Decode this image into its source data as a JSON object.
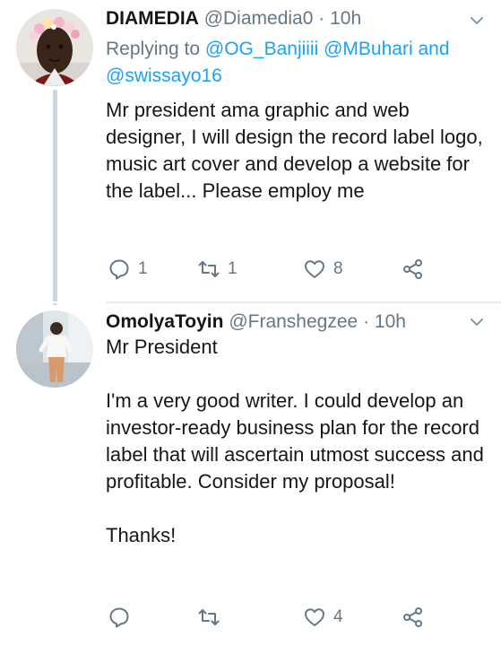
{
  "tweets": [
    {
      "name": "DIAMEDIA",
      "handle": "@Diamedia0",
      "separator": "·",
      "time": "10h",
      "replying_prefix": "Replying to",
      "replying_to": [
        "@OG_Banjiiii",
        "@MBuhari",
        "@swissayo16"
      ],
      "replying_and": "and",
      "text": "Mr president ama graphic and web designer, I will design the record label logo, music art cover and develop a website for the label... Please employ me",
      "counts": {
        "reply": "1",
        "retweet": "1",
        "like": "8"
      },
      "icons": {
        "reply": "reply-icon",
        "retweet": "retweet-icon",
        "like": "heart-icon",
        "share": "share-icon",
        "caret": "chevron-down-icon"
      }
    },
    {
      "name": "OmolyaToyin",
      "handle": "@Franshegzee",
      "separator": "·",
      "time": "10h",
      "text": "Mr President\n\nI'm a very good writer. I could develop an investor-ready business plan for the record label that will ascertain utmost success and profitable. Consider my proposal!\n\n                              Thanks!",
      "counts": {
        "reply": "",
        "retweet": "",
        "like": "4"
      },
      "icons": {
        "reply": "reply-icon",
        "retweet": "retweet-icon",
        "like": "heart-icon",
        "share": "share-icon",
        "caret": "chevron-down-icon"
      }
    }
  ],
  "colors": {
    "text": "#14171a",
    "meta": "#657786",
    "link": "#1da1f2",
    "thread_line": "#cdd6dd",
    "divider": "#e6ecf0"
  }
}
